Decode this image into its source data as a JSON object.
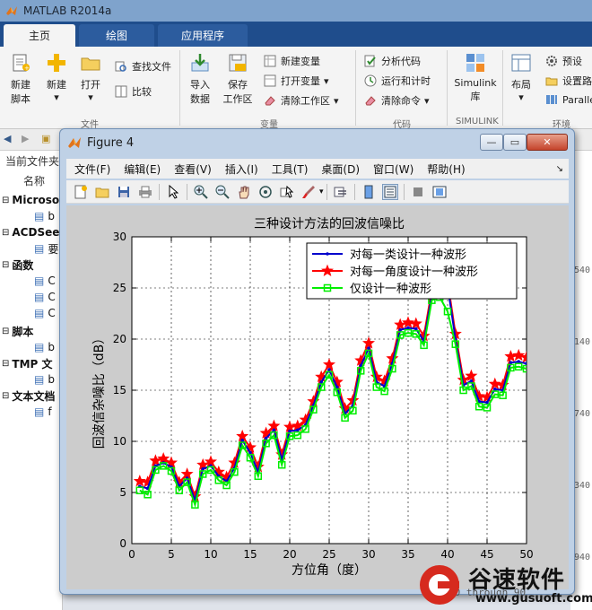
{
  "app": {
    "title": "MATLAB R2014a",
    "tabs": [
      "主页",
      "绘图",
      "应用程序"
    ]
  },
  "ribbon": {
    "groups": {
      "file": "文件",
      "variable": "变量",
      "code": "代码",
      "simulink": "SIMULINK",
      "environment": "环境"
    },
    "new_script": [
      "新建",
      "脚本"
    ],
    "new": "新建",
    "open": "打开",
    "find_files": "查找文件",
    "compare": "比较",
    "import_data": [
      "导入",
      "数据"
    ],
    "save_workspace": [
      "保存",
      "工作区"
    ],
    "new_variable": "新建变量",
    "open_variable": "打开变量",
    "clear_workspace": "清除工作区",
    "analyze_code": "分析代码",
    "run_and_time": "运行和计时",
    "clear_commands": "清除命令",
    "simulink": [
      "Simulink",
      "库"
    ],
    "layout": "布局",
    "preferences": "预设",
    "set_path": "设置路",
    "parallel": "Paralle"
  },
  "left_panel": {
    "header": "当前文件夹",
    "col_name": "名称",
    "items": [
      {
        "text": "Microso",
        "bold": true
      },
      {
        "text": "b",
        "bold": false
      },
      {
        "text": "ACDSee",
        "bold": true
      },
      {
        "text": "要",
        "bold": false
      },
      {
        "text": "函数",
        "bold": true
      },
      {
        "text": "C",
        "bold": false
      },
      {
        "text": "C",
        "bold": false
      },
      {
        "text": "C",
        "bold": false
      },
      {
        "text": "脚本",
        "bold": true
      },
      {
        "text": "b",
        "bold": false
      },
      {
        "text": "TMP 文",
        "bold": true
      },
      {
        "text": "b",
        "bold": false
      },
      {
        "text": "文本文档",
        "bold": true
      },
      {
        "text": "f",
        "bold": false
      }
    ]
  },
  "right_panel": {
    "numbers": [
      "540",
      "140",
      "740",
      "340",
      "940"
    ]
  },
  "figure": {
    "title": "Figure 4",
    "menu": [
      "文件(F)",
      "编辑(E)",
      "查看(V)",
      "插入(I)",
      "工具(T)",
      "桌面(D)",
      "窗口(W)",
      "帮助(H)"
    ]
  },
  "chart_data": {
    "type": "line",
    "title": "三种设计方法的回波信噪比",
    "xlabel": "方位角（度）",
    "ylabel": "回波信杂噪比（dB）",
    "xlim": [
      0,
      50
    ],
    "ylim": [
      0,
      30
    ],
    "xticks": [
      0,
      5,
      10,
      15,
      20,
      25,
      30,
      35,
      40,
      45,
      50
    ],
    "yticks": [
      0,
      5,
      10,
      15,
      20,
      25,
      30
    ],
    "grid": true,
    "legend_position": "top-right",
    "x": [
      1,
      2,
      3,
      4,
      5,
      6,
      7,
      8,
      9,
      10,
      11,
      12,
      13,
      14,
      15,
      16,
      17,
      18,
      19,
      20,
      21,
      22,
      23,
      24,
      25,
      26,
      27,
      28,
      29,
      30,
      31,
      32,
      33,
      34,
      35,
      36,
      37,
      38,
      39,
      40,
      41,
      42,
      43,
      44,
      45,
      46,
      47,
      48,
      49,
      50
    ],
    "series": [
      {
        "name": "对每一类设计一种波形",
        "color": "#0000cc",
        "marker": "dot",
        "values": [
          5.6,
          5.4,
          7.6,
          7.9,
          7.5,
          5.6,
          6.4,
          4.2,
          7.3,
          7.6,
          6.6,
          6.1,
          7.4,
          10.1,
          8.9,
          7.0,
          10.3,
          11.1,
          8.2,
          11.0,
          11.1,
          11.6,
          13.5,
          15.8,
          17.0,
          15.3,
          12.7,
          13.5,
          17.4,
          19.1,
          15.8,
          15.4,
          17.6,
          20.9,
          21.1,
          21.0,
          19.8,
          24.3,
          24.7,
          25.2,
          20.0,
          15.5,
          15.9,
          13.9,
          13.8,
          15.1,
          15.0,
          17.7,
          17.8,
          17.6
        ]
      },
      {
        "name": "对每一角度设计一种波形",
        "color": "#ff0000",
        "marker": "star",
        "values": [
          6.1,
          6.0,
          8.1,
          8.3,
          7.9,
          6.0,
          6.8,
          4.6,
          7.7,
          8.0,
          7.0,
          6.5,
          7.9,
          10.5,
          9.4,
          7.5,
          10.8,
          11.5,
          8.7,
          11.4,
          11.5,
          12.1,
          13.9,
          16.3,
          17.5,
          15.8,
          13.2,
          14.0,
          17.9,
          19.6,
          16.3,
          15.9,
          18.1,
          21.4,
          21.6,
          21.5,
          20.3,
          24.8,
          25.2,
          25.7,
          20.5,
          16.0,
          16.4,
          14.4,
          14.3,
          15.6,
          15.5,
          18.3,
          18.4,
          18.2
        ]
      },
      {
        "name": "仅设计一种波形",
        "color": "#00ee00",
        "marker": "square",
        "values": [
          5.2,
          4.8,
          7.2,
          7.6,
          7.1,
          5.2,
          6.0,
          3.8,
          6.8,
          7.2,
          6.2,
          5.7,
          7.0,
          9.6,
          8.4,
          6.6,
          9.8,
          10.6,
          7.7,
          10.5,
          10.6,
          11.2,
          13.1,
          15.3,
          16.5,
          14.8,
          12.3,
          13.0,
          16.9,
          18.6,
          15.3,
          14.9,
          17.1,
          20.4,
          20.6,
          20.5,
          19.4,
          23.8,
          24.1,
          22.7,
          19.5,
          15.0,
          15.4,
          13.4,
          13.3,
          14.6,
          14.5,
          17.2,
          17.3,
          17.1
        ]
      }
    ]
  },
  "watermark": {
    "brand": "谷速软件",
    "url": "www.gusuoft.com",
    "partial_text": "10 through 90"
  }
}
